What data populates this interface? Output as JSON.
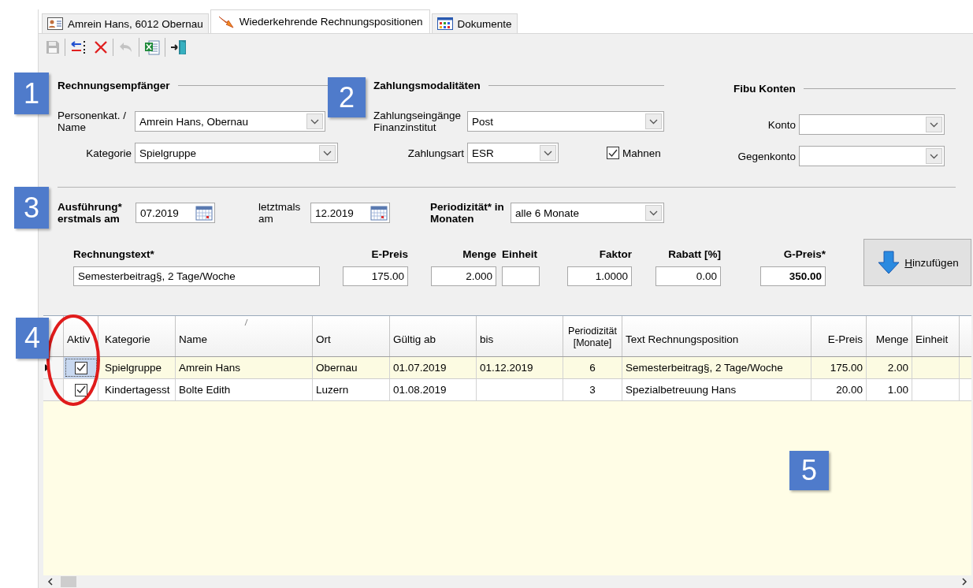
{
  "tabs": [
    {
      "label": "Amrein Hans, 6012 Obernau",
      "kind": "contact",
      "selected": false
    },
    {
      "label": "Wiederkehrende Rechnungspositionen",
      "kind": "recurring",
      "selected": true
    },
    {
      "label": "Dokumente",
      "kind": "documents",
      "selected": false
    }
  ],
  "toolbar": {
    "groups": [
      {
        "buttons": [
          {
            "kind": "save",
            "disabled": true
          }
        ]
      },
      {
        "buttons": [
          {
            "kind": "insert",
            "disabled": false
          },
          {
            "kind": "delete",
            "disabled": false
          }
        ]
      },
      {
        "buttons": [
          {
            "kind": "undo",
            "disabled": true
          }
        ]
      },
      {
        "buttons": [
          {
            "kind": "excel",
            "disabled": false
          }
        ]
      },
      {
        "buttons": [
          {
            "kind": "exit",
            "disabled": false
          }
        ]
      }
    ]
  },
  "recipient": {
    "title": "Rechnungsempfänger",
    "fields": [
      {
        "label": "Personenkat. / Name",
        "value": "Amrein Hans, Obernau"
      },
      {
        "label": "Kategorie",
        "value": "Spielgruppe"
      }
    ]
  },
  "payment": {
    "title": "Zahlungsmodalitäten",
    "fields": [
      {
        "label": "Zahlungseingänge Finanzinstitut",
        "value": "Post"
      },
      {
        "label": "Zahlungsart",
        "value": "ESR"
      }
    ],
    "dunning": {
      "label": "Mahnen",
      "checked": true
    }
  },
  "accounts": {
    "title": "Fibu Konten",
    "fields": [
      {
        "label": "Konto"
      },
      {
        "label": "Gegenkonto"
      }
    ]
  },
  "schedule": {
    "first": {
      "label": "Ausführung* erstmals am",
      "value": "07.2019"
    },
    "last": {
      "label": "letztmals am",
      "value": "12.2019"
    },
    "period": {
      "label": "Periodizität* in Monaten",
      "value": "alle 6 Monate"
    }
  },
  "entry": {
    "fields": [
      {
        "label": "Rechnungstext*",
        "value": "Semesterbeitrag§, 2 Tage/Woche",
        "kind": "text"
      },
      {
        "label": "E-Preis",
        "value": "175.00",
        "kind": "number"
      },
      {
        "label": "Menge",
        "value": "2.000",
        "kind": "number"
      },
      {
        "label": "Einheit",
        "kind": "text"
      },
      {
        "label": "Faktor",
        "value": "1.0000",
        "kind": "number"
      },
      {
        "label": "Rabatt [%]",
        "value": "0.00",
        "kind": "number"
      },
      {
        "label": "G-Preis*",
        "value": "350.00",
        "kind": "total"
      }
    ],
    "add_button": "Hinzufügen"
  },
  "grid": {
    "check_column": {
      "label": "Aktiv",
      "sorted": false
    },
    "columns": [
      {
        "label": "Kategorie",
        "kind": "text",
        "sorted": false
      },
      {
        "label": "Name",
        "kind": "text",
        "sorted": true
      },
      {
        "label": "Ort",
        "kind": "text",
        "sorted": false
      },
      {
        "label": "Gültig ab",
        "kind": "text",
        "sorted": false
      },
      {
        "label": "bis",
        "kind": "text",
        "sorted": false
      },
      {
        "label": "Periodizität [Monate]",
        "kind": "center",
        "sorted": false
      },
      {
        "label": "Text Rechnungsposition",
        "kind": "text",
        "sorted": false
      },
      {
        "label": "E-Preis",
        "kind": "number",
        "sorted": false
      },
      {
        "label": "Menge",
        "kind": "number",
        "sorted": false
      },
      {
        "label": "Einheit",
        "kind": "text",
        "sorted": false
      }
    ],
    "rows": [
      {
        "selected": true,
        "active": true,
        "cells": [
          "Spielgruppe",
          "Amrein Hans",
          "Obernau",
          "01.07.2019",
          "01.12.2019",
          "6",
          "Semesterbeitrag§, 2 Tage/Woche",
          "175.00",
          "2.00"
        ]
      },
      {
        "selected": false,
        "active": true,
        "cells": [
          "Kindertagesst",
          "Bolte Edith",
          "Luzern",
          "01.08.2019",
          null,
          "3",
          "Spezialbetreuung Hans",
          "20.00",
          "1.00"
        ]
      }
    ]
  },
  "callouts": [
    "1",
    "2",
    "3",
    "4",
    "5"
  ]
}
